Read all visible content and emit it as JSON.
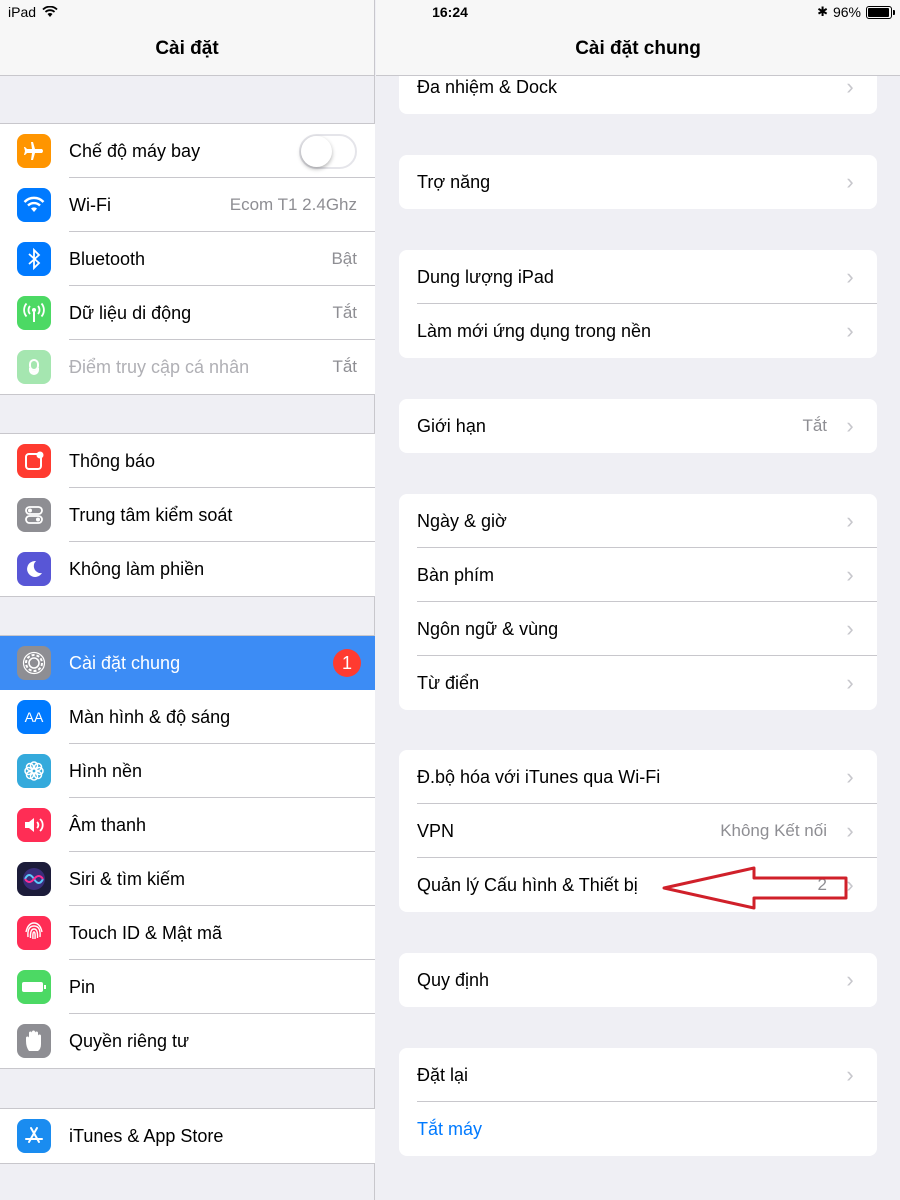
{
  "status_bar": {
    "device": "iPad",
    "time": "16:24",
    "battery": "96%",
    "battery_level": 0.96
  },
  "left_pane": {
    "title": "Cài đặt",
    "groups": [
      [
        {
          "label": "Chế độ máy bay",
          "icon": "airplane-icon",
          "color": "#ff9500",
          "toggle": false
        },
        {
          "label": "Wi-Fi",
          "icon": "wifi-icon",
          "color": "#007aff",
          "value": "Ecom T1 2.4Ghz"
        },
        {
          "label": "Bluetooth",
          "icon": "bluetooth-icon",
          "color": "#007aff",
          "value": "Bật"
        },
        {
          "label": "Dữ liệu di động",
          "icon": "cellular-icon",
          "color": "#4cd964",
          "value": "Tắt"
        },
        {
          "label": "Điểm truy cập cá nhân",
          "icon": "hotspot-icon",
          "color": "#a5e6b0",
          "value": "Tắt"
        }
      ],
      [
        {
          "label": "Thông báo",
          "icon": "notifications-icon",
          "color": "#ff3b30"
        },
        {
          "label": "Trung tâm kiểm soát",
          "icon": "control-center-icon",
          "color": "#8e8e93"
        },
        {
          "label": "Không làm phiền",
          "icon": "moon-icon",
          "color": "#5856d6"
        }
      ],
      [
        {
          "label": "Cài đặt chung",
          "icon": "gear-icon",
          "color": "#8e8e93",
          "badge": "1"
        },
        {
          "label": "Màn hình & độ sáng",
          "icon": "display-icon",
          "color": "#007aff",
          "glyph": "AA"
        },
        {
          "label": "Hình nền",
          "icon": "wallpaper-icon",
          "color": "#34aadc"
        },
        {
          "label": "Âm thanh",
          "icon": "speaker-icon",
          "color": "#ff2d55"
        },
        {
          "label": "Siri & tìm kiếm",
          "icon": "siri-icon",
          "color": "#1c1c3a"
        },
        {
          "label": "Touch ID & Mật mã",
          "icon": "fingerprint-icon",
          "color": "#ff2d55"
        },
        {
          "label": "Pin",
          "icon": "battery-icon",
          "color": "#4cd964"
        },
        {
          "label": "Quyền riêng tư",
          "icon": "hand-icon",
          "color": "#8e8e93"
        }
      ],
      [
        {
          "label": "iTunes & App Store",
          "icon": "app-store-icon",
          "color": "#1a8cf0"
        }
      ]
    ]
  },
  "right_pane": {
    "title": "Cài đặt chung",
    "cards": [
      [
        {
          "label": "Đa nhiệm & Dock"
        }
      ],
      [
        {
          "label": "Trợ năng"
        }
      ],
      [
        {
          "label": "Dung lượng iPad"
        },
        {
          "label": "Làm mới ứng dụng trong nền"
        }
      ],
      [
        {
          "label": "Giới hạn",
          "value": "Tắt"
        }
      ],
      [
        {
          "label": "Ngày & giờ"
        },
        {
          "label": "Bàn phím"
        },
        {
          "label": "Ngôn ngữ & vùng"
        },
        {
          "label": "Từ điển"
        }
      ],
      [
        {
          "label": "Đ.bộ hóa với iTunes qua Wi-Fi"
        },
        {
          "label": "VPN",
          "value": "Không Kết nối"
        },
        {
          "label": "Quản lý Cấu hình & Thiết bị",
          "value": "2"
        }
      ],
      [
        {
          "label": "Quy định"
        }
      ],
      [
        {
          "label": "Đặt lại"
        },
        {
          "label": "Tắt máy"
        }
      ]
    ]
  },
  "colors": {
    "selected_row": "#3c8cf5",
    "link": "#007aff",
    "annotation_arrow": "#d0202a"
  }
}
